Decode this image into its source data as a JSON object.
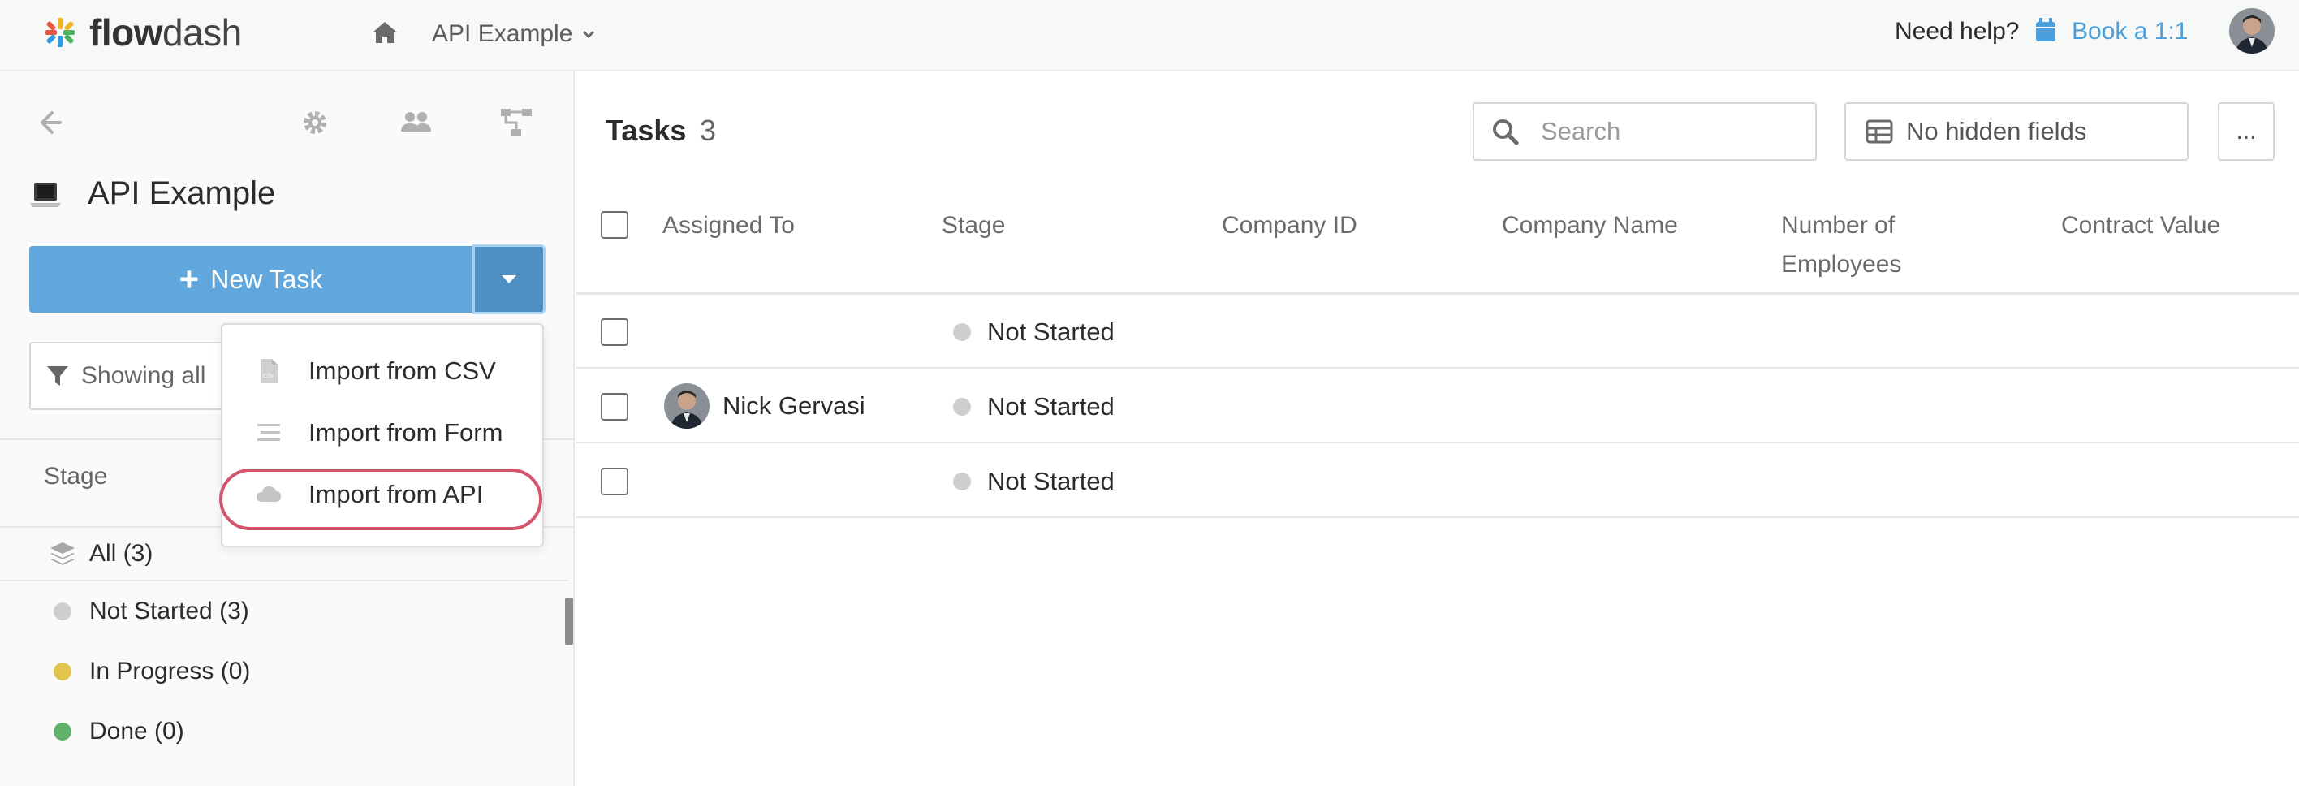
{
  "topbar": {
    "logo_text_bold": "flow",
    "logo_text_light": "dash",
    "breadcrumb": "API Example",
    "help_text": "Need help?",
    "book_link": "Book a 1:1"
  },
  "sidebar": {
    "project_title": "API Example",
    "new_task_label": "New Task",
    "filter_label": "Showing all",
    "stage_header": "Stage",
    "stages": [
      {
        "label": "All (3)"
      },
      {
        "label": "Not Started (3)",
        "color": "#cfcfcf"
      },
      {
        "label": "In Progress (0)",
        "color": "#e0c44b"
      },
      {
        "label": "Done (0)",
        "color": "#5fb06b"
      }
    ]
  },
  "dropdown": {
    "items": [
      {
        "label": "Import from CSV",
        "icon": "csv-file-icon"
      },
      {
        "label": "Import from Form",
        "icon": "form-lines-icon"
      },
      {
        "label": "Import from API",
        "icon": "cloud-icon"
      }
    ]
  },
  "main": {
    "title": "Tasks",
    "count": "3",
    "search_placeholder": "Search",
    "hidden_fields_label": "No hidden fields",
    "more_label": "...",
    "columns": {
      "assigned_to": "Assigned To",
      "stage": "Stage",
      "company_id": "Company ID",
      "company_name": "Company Name",
      "employees_line1": "Number of",
      "employees_line2": "Employees",
      "contract_value": "Contract Value"
    },
    "rows": [
      {
        "assignee": "",
        "stage": "Not Started"
      },
      {
        "assignee": "Nick Gervasi",
        "stage": "Not Started"
      },
      {
        "assignee": "",
        "stage": "Not Started"
      }
    ],
    "stage_dot_color": "#cfcfcf"
  },
  "colors": {
    "accent": "#5fa7dd",
    "link": "#4a9fdc",
    "highlight": "#d4556e"
  }
}
